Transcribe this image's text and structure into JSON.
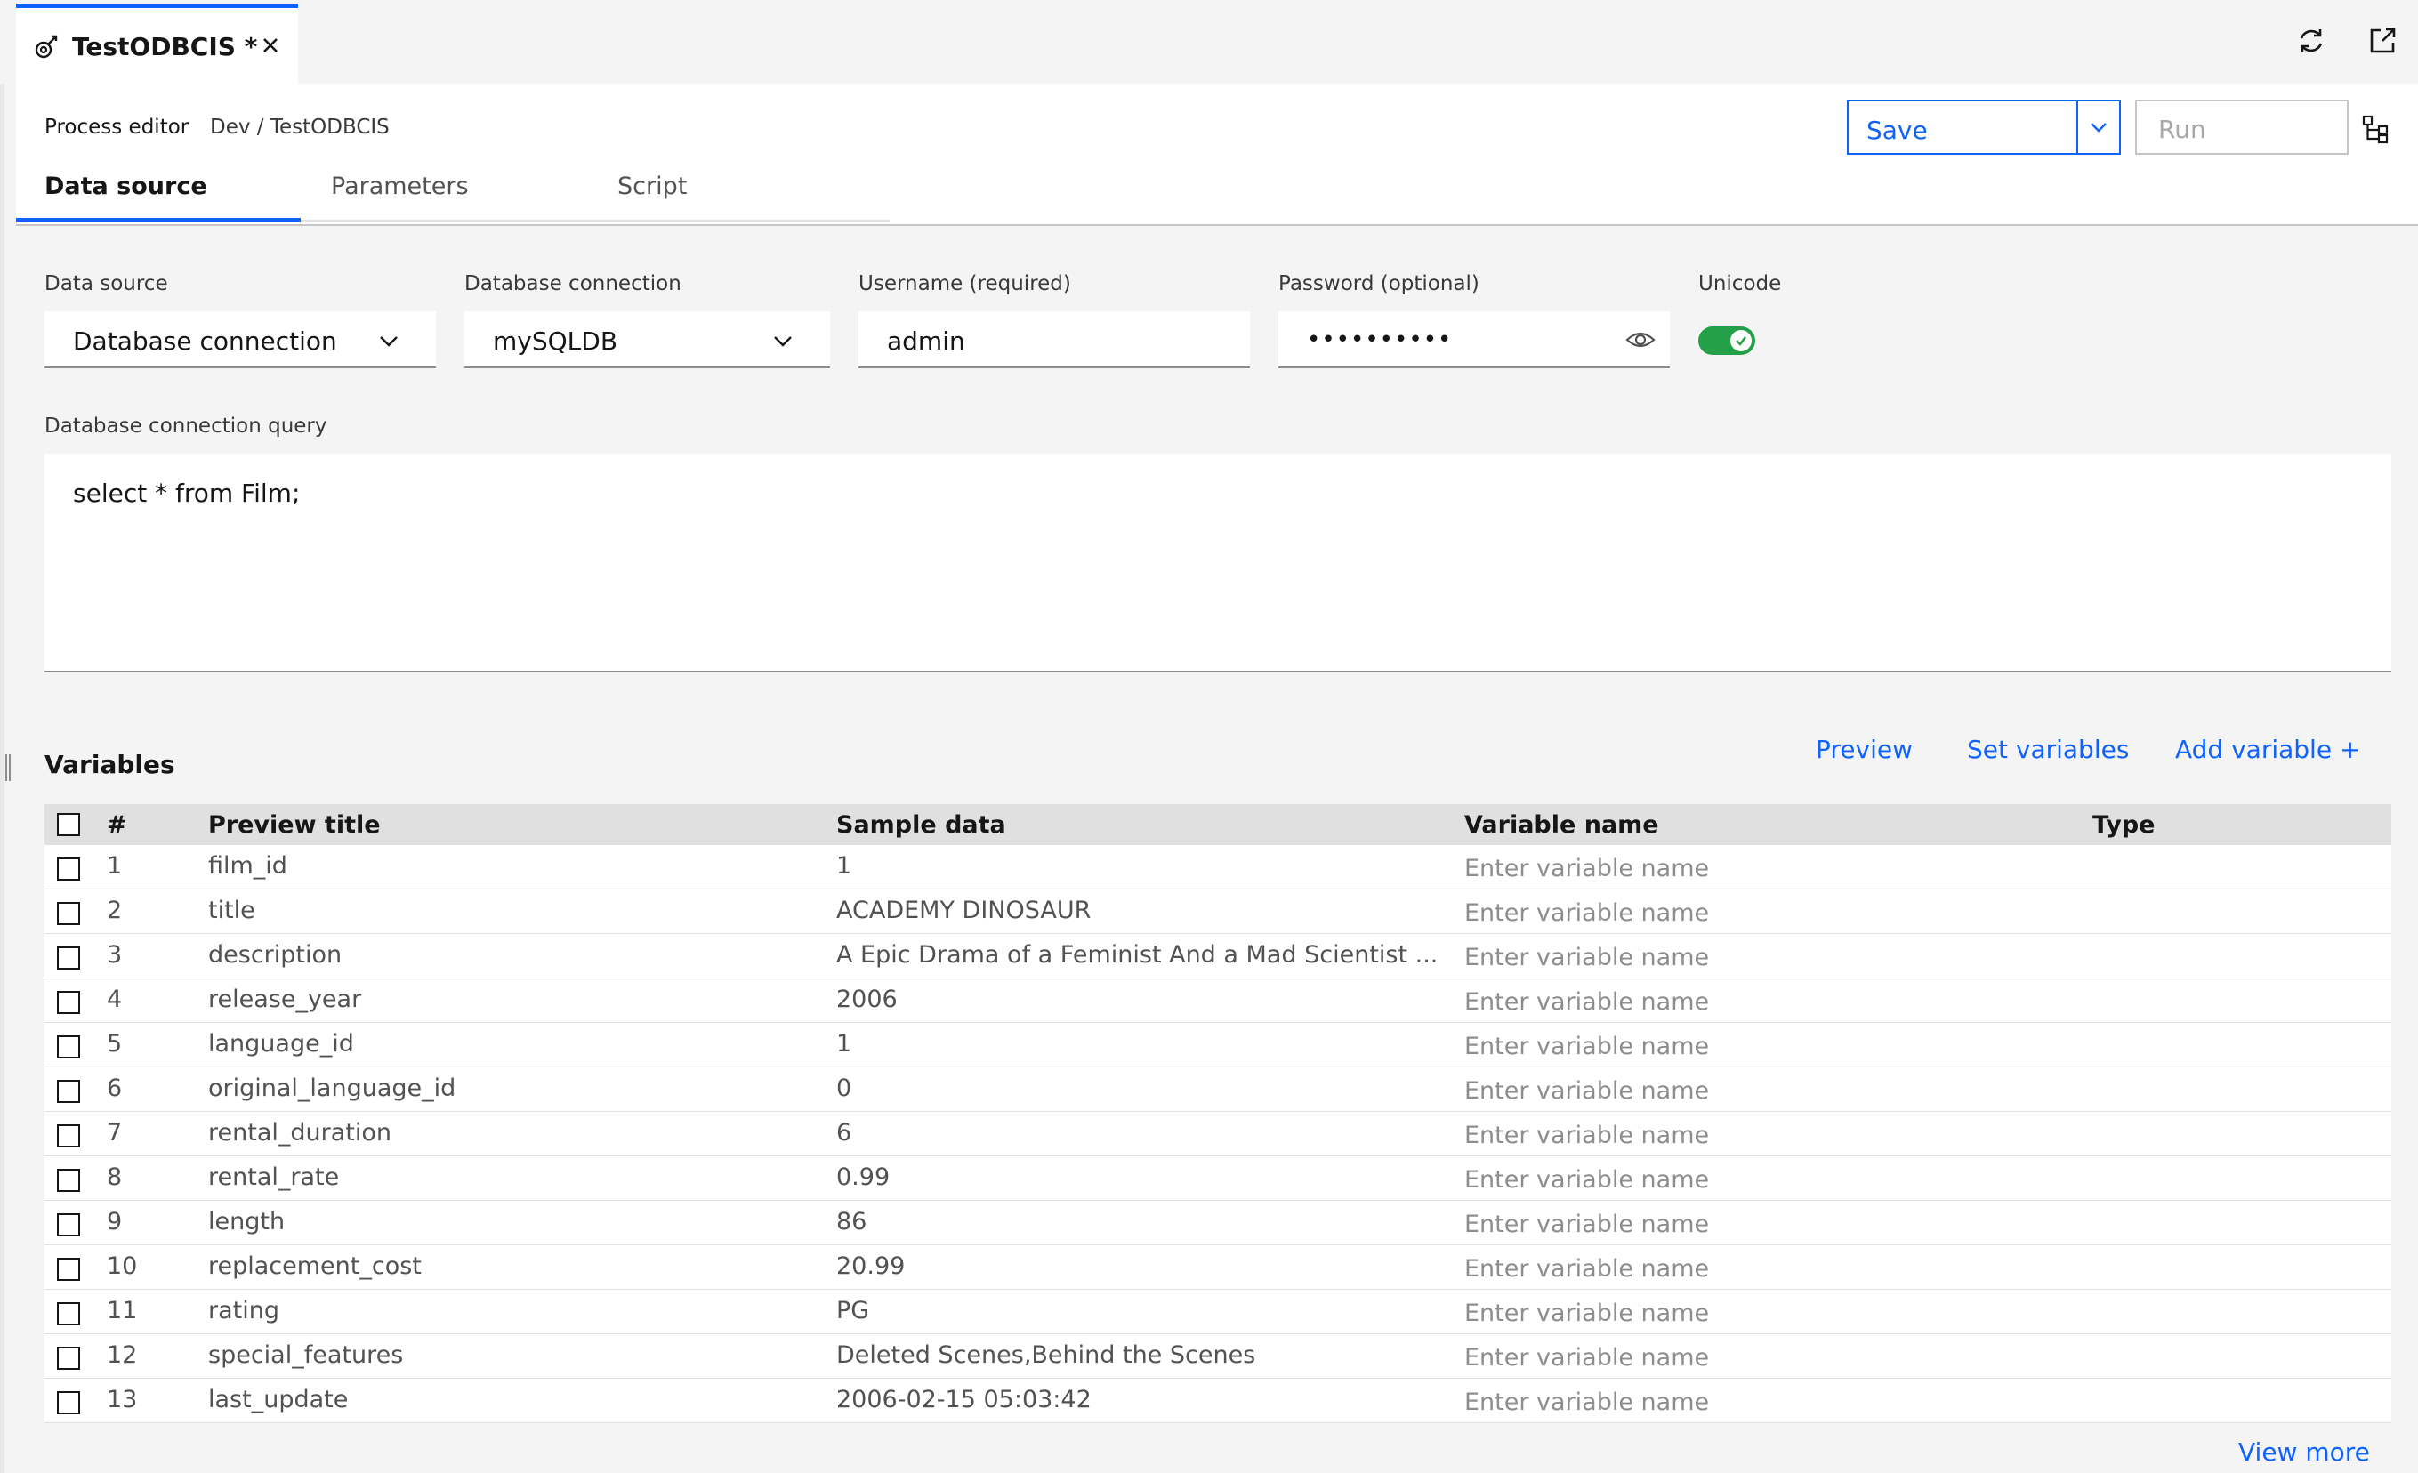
{
  "tab": {
    "title": "TestODBCIS *"
  },
  "header": {
    "process_editor_label": "Process editor",
    "breadcrumb": "Dev / TestODBCIS",
    "save_label": "Save",
    "run_label": "Run"
  },
  "tabs": [
    {
      "label": "Data source",
      "active": true
    },
    {
      "label": "Parameters",
      "active": false
    },
    {
      "label": "Script",
      "active": false
    }
  ],
  "form": {
    "data_source_label": "Data source",
    "data_source_value": "Database connection",
    "db_connection_label": "Database connection",
    "db_connection_value": "mySQLDB",
    "username_label": "Username (required)",
    "username_value": "admin",
    "password_label": "Password (optional)",
    "password_value": "••••••••••",
    "unicode_label": "Unicode",
    "unicode_on": true,
    "query_label": "Database connection query",
    "query_value": "select * from Film;"
  },
  "variables": {
    "title": "Variables",
    "preview_label": "Preview",
    "set_variables_label": "Set variables",
    "add_variable_label": "Add variable  +",
    "columns": [
      "#",
      "Preview title",
      "Sample data",
      "Variable name",
      "Type"
    ],
    "placeholder": "Enter variable name",
    "rows": [
      {
        "num": "1",
        "title": "film_id",
        "sample": "1"
      },
      {
        "num": "2",
        "title": "title",
        "sample": "ACADEMY DINOSAUR"
      },
      {
        "num": "3",
        "title": "description",
        "sample": "A Epic Drama of a Feminist And a Mad Scientist ..."
      },
      {
        "num": "4",
        "title": "release_year",
        "sample": "2006"
      },
      {
        "num": "5",
        "title": "language_id",
        "sample": "1"
      },
      {
        "num": "6",
        "title": "original_language_id",
        "sample": "0"
      },
      {
        "num": "7",
        "title": "rental_duration",
        "sample": "6"
      },
      {
        "num": "8",
        "title": "rental_rate",
        "sample": "0.99"
      },
      {
        "num": "9",
        "title": "length",
        "sample": "86"
      },
      {
        "num": "10",
        "title": "replacement_cost",
        "sample": "20.99"
      },
      {
        "num": "11",
        "title": "rating",
        "sample": "PG"
      },
      {
        "num": "12",
        "title": "special_features",
        "sample": "Deleted Scenes,Behind the Scenes"
      },
      {
        "num": "13",
        "title": "last_update",
        "sample": "2006-02-15 05:03:42"
      }
    ],
    "view_more_label": "View more"
  },
  "colors": {
    "accent": "#0f62fe",
    "toggle_on": "#24a148"
  }
}
